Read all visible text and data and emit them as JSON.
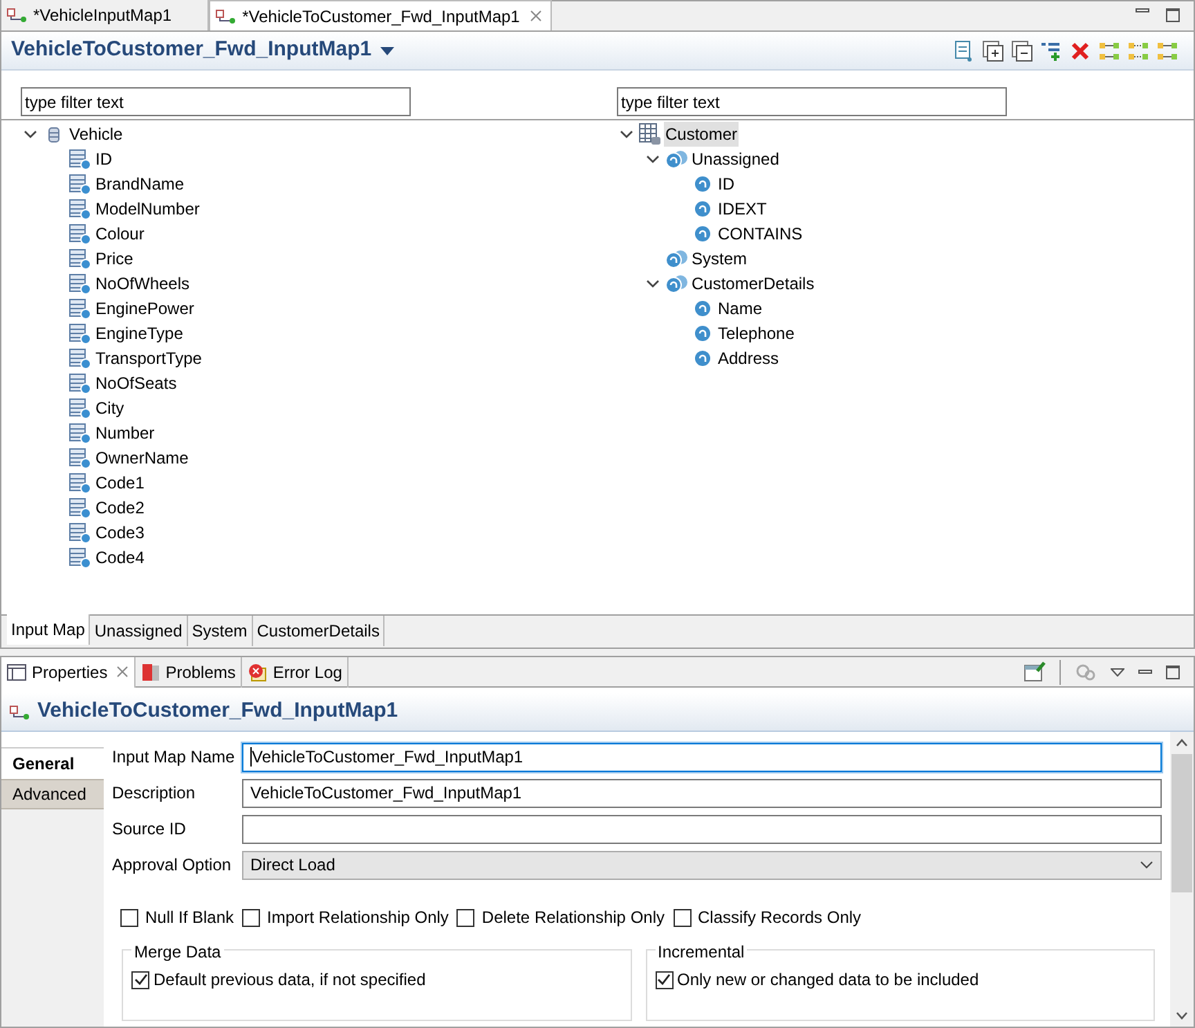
{
  "editor_tabs": [
    {
      "label": "*VehicleInputMap1",
      "selected": false
    },
    {
      "label": "*VehicleToCustomer_Fwd_InputMap1",
      "selected": true
    }
  ],
  "editor": {
    "title": "VehicleToCustomer_Fwd_InputMap1",
    "left_tree": {
      "filter": {
        "placeholder": "type filter text"
      },
      "items": [
        {
          "label": "Vehicle",
          "kind": "entity",
          "expanded": true,
          "selected": false,
          "children": [
            {
              "label": "ID",
              "kind": "field"
            },
            {
              "label": "BrandName",
              "kind": "field"
            },
            {
              "label": "ModelNumber",
              "kind": "field"
            },
            {
              "label": "Colour",
              "kind": "field"
            },
            {
              "label": "Price",
              "kind": "field"
            },
            {
              "label": "NoOfWheels",
              "kind": "field"
            },
            {
              "label": "EnginePower",
              "kind": "field"
            },
            {
              "label": "EngineType",
              "kind": "field"
            },
            {
              "label": "TransportType",
              "kind": "field"
            },
            {
              "label": "NoOfSeats",
              "kind": "field"
            },
            {
              "label": "City",
              "kind": "field"
            },
            {
              "label": "Number",
              "kind": "field"
            },
            {
              "label": "OwnerName",
              "kind": "field"
            },
            {
              "label": "Code1",
              "kind": "field"
            },
            {
              "label": "Code2",
              "kind": "field"
            },
            {
              "label": "Code3",
              "kind": "field"
            },
            {
              "label": "Code4",
              "kind": "field"
            }
          ]
        }
      ]
    },
    "right_tree": {
      "filter": {
        "placeholder": "type filter text"
      },
      "items": [
        {
          "label": "Customer",
          "kind": "table",
          "expanded": true,
          "selected": true,
          "children": [
            {
              "label": "Unassigned",
              "kind": "group",
              "expanded": true,
              "children": [
                {
                  "label": "ID",
                  "kind": "attribute"
                },
                {
                  "label": "IDEXT",
                  "kind": "attribute"
                },
                {
                  "label": "CONTAINS",
                  "kind": "attribute"
                }
              ]
            },
            {
              "label": "System",
              "kind": "group"
            },
            {
              "label": "CustomerDetails",
              "kind": "group",
              "expanded": true,
              "children": [
                {
                  "label": "Name",
                  "kind": "attribute"
                },
                {
                  "label": "Telephone",
                  "kind": "attribute"
                },
                {
                  "label": "Address",
                  "kind": "attribute"
                }
              ]
            }
          ]
        }
      ]
    },
    "page_tabs": [
      {
        "label": "Input Map",
        "selected": true
      },
      {
        "label": "Unassigned",
        "selected": false
      },
      {
        "label": "System",
        "selected": false
      },
      {
        "label": "CustomerDetails",
        "selected": false
      }
    ]
  },
  "view_tabs": [
    {
      "label": "Properties",
      "kind": "properties",
      "selected": true
    },
    {
      "label": "Problems",
      "kind": "problems",
      "selected": false
    },
    {
      "label": "Error Log",
      "kind": "errorlog",
      "selected": false
    }
  ],
  "properties": {
    "title": "VehicleToCustomer_Fwd_InputMap1",
    "side_tabs": [
      {
        "label": "General",
        "selected": true
      },
      {
        "label": "Advanced",
        "selected": false
      }
    ],
    "fields": [
      {
        "label": "Input Map Name",
        "kind": "text",
        "value": "VehicleToCustomer_Fwd_InputMap1",
        "focused": true
      },
      {
        "label": "Description",
        "kind": "text",
        "value": "VehicleToCustomer_Fwd_InputMap1",
        "focused": false
      },
      {
        "label": "Source ID",
        "kind": "text",
        "focused": false
      },
      {
        "label": "Approval Option",
        "kind": "select",
        "value": "Direct Load"
      }
    ],
    "options": [
      {
        "label": "Null If Blank",
        "checked": false
      },
      {
        "label": "Import Relationship Only",
        "checked": false
      },
      {
        "label": "Delete Relationship Only",
        "checked": false
      },
      {
        "label": "Classify Records Only",
        "checked": false
      }
    ],
    "groups": [
      {
        "title": "Merge Data",
        "options": [
          {
            "label": "Default previous data, if not specified",
            "checked": true
          }
        ]
      },
      {
        "title": "Incremental",
        "options": [
          {
            "label": "Only new or changed data to be included",
            "checked": true
          }
        ]
      }
    ]
  }
}
